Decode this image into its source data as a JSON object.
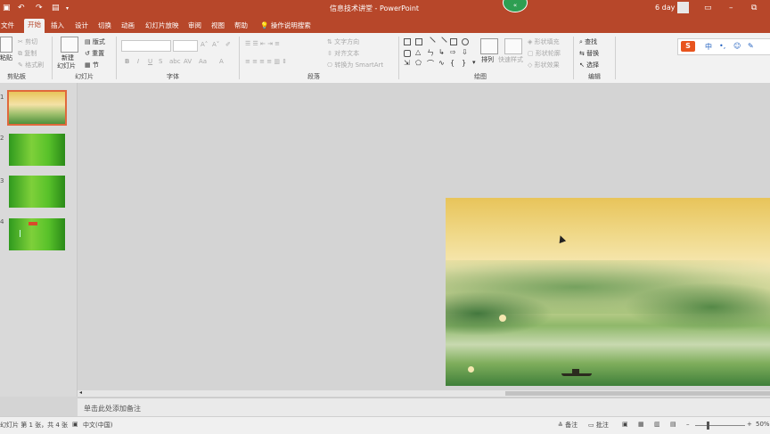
{
  "titlebar": {
    "title": "信息技术讲堂 - PowerPoint",
    "user": "6 day",
    "badge": "«"
  },
  "tabs": [
    "文件",
    "开始",
    "插入",
    "设计",
    "切换",
    "动画",
    "幻灯片放映",
    "审阅",
    "视图",
    "帮助"
  ],
  "search_hint": "操作说明搜索",
  "ribbon": {
    "clipboard": {
      "paste": "粘贴",
      "cut": "剪切",
      "copy": "复制",
      "format": "格式刷",
      "label": "剪贴板"
    },
    "slides": {
      "new": "新建",
      "new2": "幻灯片",
      "layout": "版式",
      "reset": "重置",
      "section": "节",
      "label": "幻灯片"
    },
    "font": {
      "label": "字体",
      "bold": "B",
      "italic": "I",
      "underline": "U",
      "strike": "S",
      "spacing": "AV",
      "case": "Aa",
      "color": "A"
    },
    "paragraph": {
      "label": "段落",
      "text_dir": "文字方向",
      "align_text": "对齐文本",
      "smartart": "转换为 SmartArt"
    },
    "drawing": {
      "label": "绘图",
      "arrange": "排列",
      "quick_styles": "快速样式",
      "fill": "形状填充",
      "outline": "形状轮廓",
      "effects": "形状效果"
    },
    "editing": {
      "label": "编辑",
      "find": "查找",
      "replace": "替换",
      "select": "选择"
    }
  },
  "ime": {
    "logo": "S",
    "items": [
      "中",
      "•,",
      "☺",
      "✎"
    ]
  },
  "thumbnails": [
    {
      "num": "1",
      "selected": true
    },
    {
      "num": "2",
      "selected": false
    },
    {
      "num": "3",
      "selected": false
    },
    {
      "num": "4",
      "selected": false
    }
  ],
  "notes_placeholder": "单击此处添加备注",
  "status": {
    "slide_info": "幻灯片 第 1 张，共 4 张",
    "language": "中文(中国)",
    "notes": "备注",
    "comments": "批注",
    "zoom": "50%"
  },
  "colors": {
    "accent": "#b7472a",
    "thumb_green": "#3fae2a"
  }
}
